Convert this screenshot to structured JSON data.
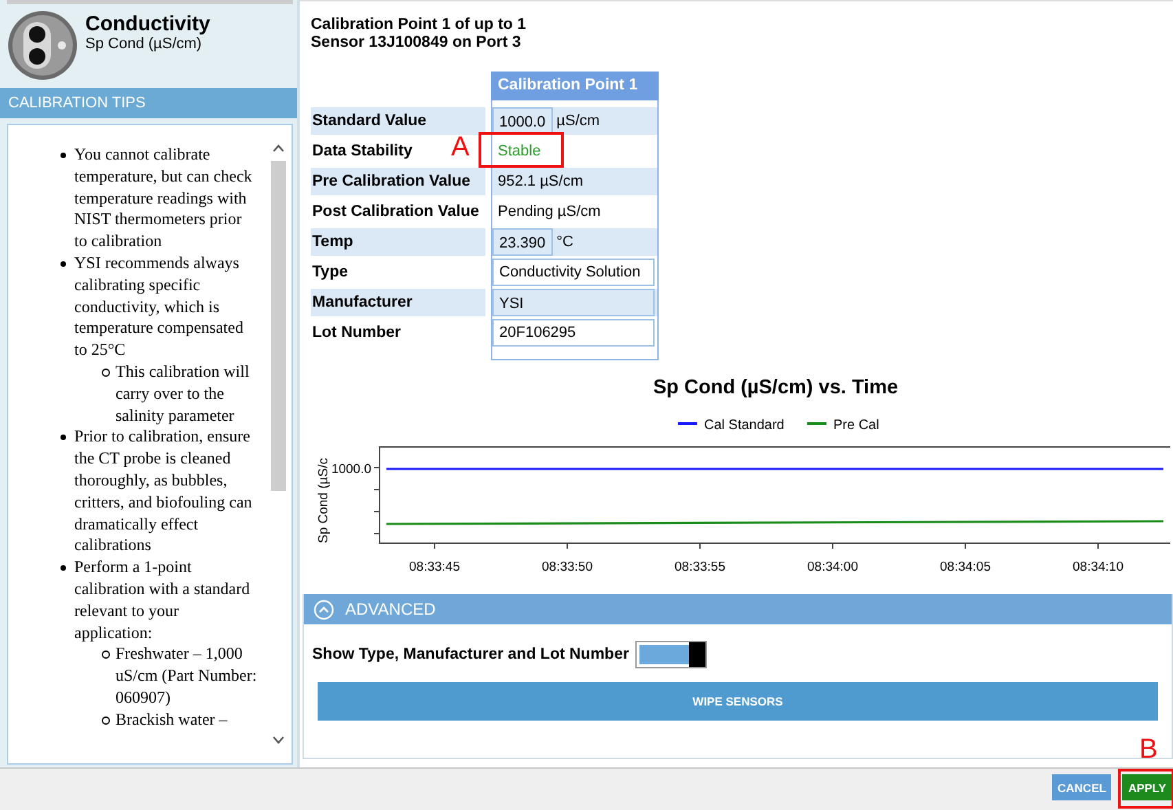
{
  "sensor": {
    "title": "Conductivity",
    "subtitle": "Sp Cond (µS/cm)"
  },
  "tips": {
    "title": "CALIBRATION TIPS",
    "items": [
      {
        "text": "You cannot calibrate temperature, but can check temperature readings with NIST thermometers prior to calibration"
      },
      {
        "text": "YSI recommends always calibrating specific conductivity, which is temperature compensated to 25°C",
        "children": [
          {
            "text": "This calibration will carry over to the salinity parameter"
          }
        ]
      },
      {
        "text": "Prior to calibration, ensure the CT probe is cleaned thoroughly, as bubbles, critters, and biofouling can dramatically effect calibrations"
      },
      {
        "text": "Perform a 1-point calibration with a standard relevant to your application:",
        "children": [
          {
            "text": "Freshwater – 1,000 uS/cm (Part Number: 060907)"
          },
          {
            "text": "Brackish water –"
          }
        ]
      }
    ]
  },
  "heading": [
    "Calibration Point 1 of up to 1",
    "Sensor 13J100849 on Port 3"
  ],
  "table": {
    "column": "Calibration Point 1",
    "rows": [
      {
        "label": "Standard Value",
        "kind": "box",
        "value": "1000.0",
        "unit": "µS/cm"
      },
      {
        "label": "Data Stability",
        "kind": "status",
        "value": "Stable",
        "callout": "A"
      },
      {
        "label": "Pre Calibration Value",
        "kind": "text",
        "value": "952.1 µS/cm"
      },
      {
        "label": "Post Calibration Value",
        "kind": "text",
        "value": "Pending µS/cm"
      },
      {
        "label": "Temp",
        "kind": "box",
        "value": "23.390",
        "unit": "°C"
      },
      {
        "label": "Type",
        "kind": "input",
        "value": "Conductivity Solution"
      },
      {
        "label": "Manufacturer",
        "kind": "box",
        "value": "YSI"
      },
      {
        "label": "Lot Number",
        "kind": "input",
        "value": "20F106295"
      }
    ]
  },
  "chart": {
    "title": "Sp Cond (µS/cm) vs. Time",
    "legend": [
      {
        "name": "Cal Standard",
        "color": "#1a1aff"
      },
      {
        "name": "Pre Cal",
        "color": "#1a8c1a"
      }
    ],
    "ylabel": "Sp Cond (µS/c",
    "ytick": "1000.0",
    "xticks": [
      "08:33:45",
      "08:33:50",
      "08:33:55",
      "08:34:00",
      "08:34:05",
      "08:34:10"
    ]
  },
  "advanced": {
    "title": "ADVANCED",
    "expanded": true,
    "toggle": {
      "label": "Show Type, Manufacturer and Lot Number",
      "on": true
    },
    "button": "WIPE SENSORS"
  },
  "footer": {
    "buttons": [
      {
        "label": "CANCEL",
        "kind": "cancel"
      },
      {
        "label": "APPLY",
        "kind": "apply",
        "callout": "B"
      }
    ]
  }
}
